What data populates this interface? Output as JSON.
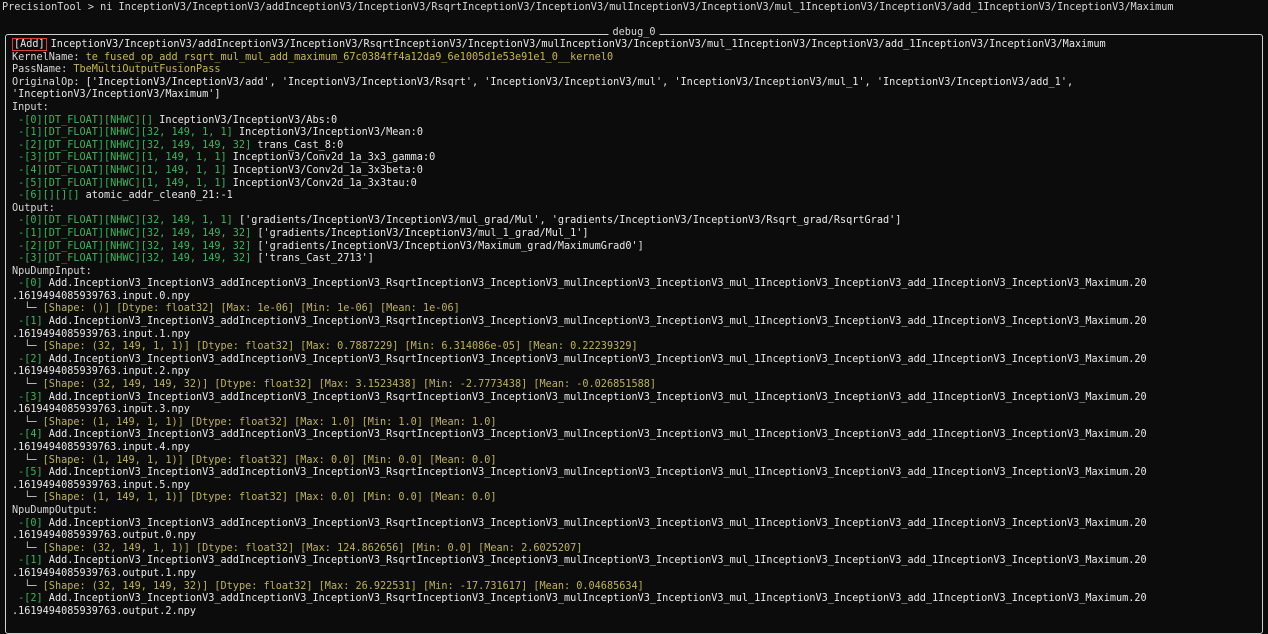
{
  "command": "PrecisionTool > ni InceptionV3/InceptionV3/addInceptionV3/InceptionV3/RsqrtInceptionV3/InceptionV3/mulInceptionV3/InceptionV3/mul_1InceptionV3/InceptionV3/add_1InceptionV3/InceptionV3/Maximum",
  "panel_title": "debug_0",
  "op_type": "[Add]",
  "op_name": "InceptionV3/InceptionV3/addInceptionV3/InceptionV3/RsqrtInceptionV3/InceptionV3/mulInceptionV3/InceptionV3/mul_1InceptionV3/InceptionV3/add_1InceptionV3/InceptionV3/Maximum",
  "kernel_label": "KernelName:",
  "kernel_value": "te_fused_op_add_rsqrt_mul_mul_add_maximum_67c0384ff4a12da9_6e1005d1e53e91e1_0__kernel0",
  "pass_label": "PassName:",
  "pass_value": "TbeMultiOutputFusionPass",
  "origin_label": "OriginalOp:",
  "origin_value": "['InceptionV3/InceptionV3/add', 'InceptionV3/InceptionV3/Rsqrt', 'InceptionV3/InceptionV3/mul', 'InceptionV3/InceptionV3/mul_1', 'InceptionV3/InceptionV3/add_1', 'InceptionV3/InceptionV3/Maximum']",
  "input_label": "Input:",
  "inputs": [
    {
      "tag": " -[0][DT_FLOAT][NHWC][]",
      "name": " InceptionV3/InceptionV3/Abs:0"
    },
    {
      "tag": " -[1][DT_FLOAT][NHWC][32, 149, 1, 1]",
      "name": " InceptionV3/InceptionV3/Mean:0"
    },
    {
      "tag": " -[2][DT_FLOAT][NHWC][32, 149, 149, 32]",
      "name": " trans_Cast_8:0"
    },
    {
      "tag": " -[3][DT_FLOAT][NHWC][1, 149, 1, 1]",
      "name": " InceptionV3/Conv2d_1a_3x3_gamma:0"
    },
    {
      "tag": " -[4][DT_FLOAT][NHWC][1, 149, 1, 1]",
      "name": " InceptionV3/Conv2d_1a_3x3beta:0"
    },
    {
      "tag": " -[5][DT_FLOAT][NHWC][1, 149, 1, 1]",
      "name": " InceptionV3/Conv2d_1a_3x3tau:0"
    },
    {
      "tag": " -[6][][][]",
      "name": " atomic_addr_clean0_21:-1"
    }
  ],
  "output_label": "Output:",
  "outputs": [
    {
      "tag": " -[0][DT_FLOAT][NHWC][32, 149, 1, 1]",
      "name": " ['gradients/InceptionV3/InceptionV3/mul_grad/Mul', 'gradients/InceptionV3/InceptionV3/Rsqrt_grad/RsqrtGrad']"
    },
    {
      "tag": " -[1][DT_FLOAT][NHWC][32, 149, 149, 32]",
      "name": " ['gradients/InceptionV3/InceptionV3/mul_1_grad/Mul_1']"
    },
    {
      "tag": " -[2][DT_FLOAT][NHWC][32, 149, 149, 32]",
      "name": " ['gradients/InceptionV3/InceptionV3/Maximum_grad/MaximumGrad0']"
    },
    {
      "tag": " -[3][DT_FLOAT][NHWC][32, 149, 149, 32]",
      "name": " ['trans_Cast_2713']"
    }
  ],
  "npu_input_label": "NpuDumpInput:",
  "npu_inputs": [
    {
      "idx": " -[0]",
      "file": " Add.InceptionV3_InceptionV3_addInceptionV3_InceptionV3_RsqrtInceptionV3_InceptionV3_mulInceptionV3_InceptionV3_mul_1InceptionV3_InceptionV3_add_1InceptionV3_InceptionV3_Maximum.20",
      "file2": ".1619494085939763.input.0.npy",
      "tree": "  └─ ",
      "stat": "[Shape: ()] [Dtype: float32] [Max: 1e-06] [Min: 1e-06] [Mean: 1e-06]"
    },
    {
      "idx": " -[1]",
      "file": " Add.InceptionV3_InceptionV3_addInceptionV3_InceptionV3_RsqrtInceptionV3_InceptionV3_mulInceptionV3_InceptionV3_mul_1InceptionV3_InceptionV3_add_1InceptionV3_InceptionV3_Maximum.20",
      "file2": ".1619494085939763.input.1.npy",
      "tree": "  └─ ",
      "stat": "[Shape: (32, 149, 1, 1)] [Dtype: float32] [Max: 0.7887229] [Min: 6.314086e-05] [Mean: 0.22239329]"
    },
    {
      "idx": " -[2]",
      "file": " Add.InceptionV3_InceptionV3_addInceptionV3_InceptionV3_RsqrtInceptionV3_InceptionV3_mulInceptionV3_InceptionV3_mul_1InceptionV3_InceptionV3_add_1InceptionV3_InceptionV3_Maximum.20",
      "file2": ".1619494085939763.input.2.npy",
      "tree": "  └─ ",
      "stat": "[Shape: (32, 149, 149, 32)] [Dtype: float32] [Max: 3.1523438] [Min: -2.7773438] [Mean: -0.026851588]"
    },
    {
      "idx": " -[3]",
      "file": " Add.InceptionV3_InceptionV3_addInceptionV3_InceptionV3_RsqrtInceptionV3_InceptionV3_mulInceptionV3_InceptionV3_mul_1InceptionV3_InceptionV3_add_1InceptionV3_InceptionV3_Maximum.20",
      "file2": ".1619494085939763.input.3.npy",
      "tree": "  └─ ",
      "stat": "[Shape: (1, 149, 1, 1)] [Dtype: float32] [Max: 1.0] [Min: 1.0] [Mean: 1.0]"
    },
    {
      "idx": " -[4]",
      "file": " Add.InceptionV3_InceptionV3_addInceptionV3_InceptionV3_RsqrtInceptionV3_InceptionV3_mulInceptionV3_InceptionV3_mul_1InceptionV3_InceptionV3_add_1InceptionV3_InceptionV3_Maximum.20",
      "file2": ".1619494085939763.input.4.npy",
      "tree": "  └─ ",
      "stat": "[Shape: (1, 149, 1, 1)] [Dtype: float32] [Max: 0.0] [Min: 0.0] [Mean: 0.0]"
    },
    {
      "idx": " -[5]",
      "file": " Add.InceptionV3_InceptionV3_addInceptionV3_InceptionV3_RsqrtInceptionV3_InceptionV3_mulInceptionV3_InceptionV3_mul_1InceptionV3_InceptionV3_add_1InceptionV3_InceptionV3_Maximum.20",
      "file2": ".1619494085939763.input.5.npy",
      "tree": "  └─ ",
      "stat": "[Shape: (1, 149, 1, 1)] [Dtype: float32] [Max: 0.0] [Min: 0.0] [Mean: 0.0]"
    }
  ],
  "npu_output_label": "NpuDumpOutput:",
  "npu_outputs": [
    {
      "idx": " -[0]",
      "file": " Add.InceptionV3_InceptionV3_addInceptionV3_InceptionV3_RsqrtInceptionV3_InceptionV3_mulInceptionV3_InceptionV3_mul_1InceptionV3_InceptionV3_add_1InceptionV3_InceptionV3_Maximum.20",
      "file2": ".1619494085939763.output.0.npy",
      "tree": "  └─ ",
      "stat": "[Shape: (32, 149, 1, 1)] [Dtype: float32] [Max: 124.862656] [Min: 0.0] [Mean: 2.6025207]"
    },
    {
      "idx": " -[1]",
      "file": " Add.InceptionV3_InceptionV3_addInceptionV3_InceptionV3_RsqrtInceptionV3_InceptionV3_mulInceptionV3_InceptionV3_mul_1InceptionV3_InceptionV3_add_1InceptionV3_InceptionV3_Maximum.20",
      "file2": ".1619494085939763.output.1.npy",
      "tree": "  └─ ",
      "stat": "[Shape: (32, 149, 149, 32)] [Dtype: float32] [Max: 26.922531] [Min: -17.731617] [Mean: 0.04685634]"
    },
    {
      "idx": " -[2]",
      "file": " Add.InceptionV3_InceptionV3_addInceptionV3_InceptionV3_RsqrtInceptionV3_InceptionV3_mulInceptionV3_InceptionV3_mul_1InceptionV3_InceptionV3_add_1InceptionV3_InceptionV3_Maximum.20",
      "file2": ".1619494085939763.output.2.npy",
      "tree": "",
      "stat": ""
    }
  ],
  "colors": {
    "background": "#0c0c0c",
    "text": "#d6d6d6",
    "yellow": "#c8b84a",
    "green": "#3ab65c",
    "highlight_box": "#e53935"
  }
}
